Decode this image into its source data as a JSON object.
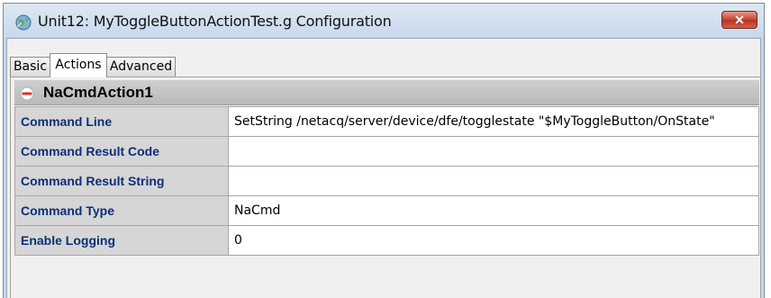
{
  "window": {
    "title": "Unit12: MyToggleButtonActionTest.g Configuration",
    "close_label": "✕"
  },
  "tabs": [
    {
      "label": "Basic",
      "active": false
    },
    {
      "label": "Actions",
      "active": true
    },
    {
      "label": "Advanced",
      "active": false
    }
  ],
  "group": {
    "title": "NaCmdAction1",
    "properties": [
      {
        "name": "Command Line",
        "value": "SetString /netacq/server/device/dfe/togglestate \"$MyToggleButton/OnState\""
      },
      {
        "name": "Command Result Code",
        "value": ""
      },
      {
        "name": "Command Result String",
        "value": ""
      },
      {
        "name": "Command Type",
        "value": "NaCmd"
      },
      {
        "name": "Enable Logging",
        "value": "0"
      }
    ]
  },
  "colors": {
    "property_label": "#0c2f78",
    "close_button": "#c9442e",
    "collapse_icon": "#d9302a"
  }
}
